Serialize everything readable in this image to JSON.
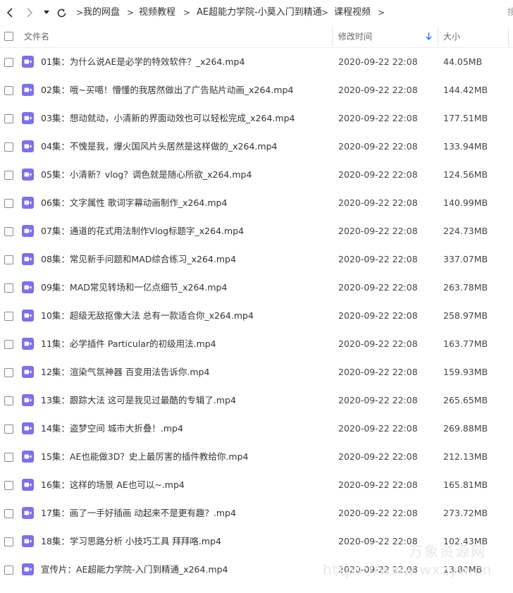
{
  "toolbar": {
    "back_icon": "chevron-left-icon",
    "forward_icon": "chevron-right-icon",
    "history_icon": "caret-down-icon",
    "refresh_icon": "refresh-icon"
  },
  "breadcrumb": [
    "我的网盘",
    "视频教程",
    "AE超能力学院-小莫入门到精通",
    "课程视频"
  ],
  "breadcrumb_separator": ">",
  "search_stub": "搜",
  "columns": {
    "name": "文件名",
    "modified": "修改时间",
    "size": "大小",
    "sort_icon": "arrow-down-icon"
  },
  "colors": {
    "video_icon": "#7c6ff0",
    "sort_arrow": "#2f7ef3"
  },
  "files": [
    {
      "name": "01集：为什么说AE是必学的特效软件？_x264.mp4",
      "modified": "2020-09-22 22:08",
      "size": "44.05MB"
    },
    {
      "name": "02集：哦~买噶！懵懂的我居然做出了广告贴片动画_x264.mp4",
      "modified": "2020-09-22 22:08",
      "size": "144.42MB"
    },
    {
      "name": "03集：想动就动，小清新的界面动效也可以轻松完成_x264.mp4",
      "modified": "2020-09-22 22:08",
      "size": "177.51MB"
    },
    {
      "name": "04集：不愧是我，爆火国风片头居然是这样做的_x264.mp4",
      "modified": "2020-09-22 22:08",
      "size": "133.94MB"
    },
    {
      "name": "05集：小清新？vlog？调色就是随心所欲_x264.mp4",
      "modified": "2020-09-22 22:08",
      "size": "124.56MB"
    },
    {
      "name": "06集：文字属性 歌词字幕动画制作_x264.mp4",
      "modified": "2020-09-22 22:08",
      "size": "140.99MB"
    },
    {
      "name": "07集：通道的花式用法制作Vlog标题字_x264.mp4",
      "modified": "2020-09-22 22:08",
      "size": "224.73MB"
    },
    {
      "name": "08集：常见新手问题和MAD综合练习_x264.mp4",
      "modified": "2020-09-22 22:08",
      "size": "337.07MB"
    },
    {
      "name": "09集：MAD常见转场和一亿点细节_x264.mp4",
      "modified": "2020-09-22 22:08",
      "size": "263.78MB"
    },
    {
      "name": "10集：超级无敌抠像大法 总有一款适合你_x264.mp4",
      "modified": "2020-09-22 22:08",
      "size": "258.97MB"
    },
    {
      "name": "11集：必学插件 Particular的初级用法.mp4",
      "modified": "2020-09-22 22:08",
      "size": "163.77MB"
    },
    {
      "name": "12集：渲染气氛神器 百变用法告诉你.mp4",
      "modified": "2020-09-22 22:08",
      "size": "159.93MB"
    },
    {
      "name": "13集：跟踪大法 这可是我见过最酷的专辑了.mp4",
      "modified": "2020-09-22 22:08",
      "size": "265.65MB"
    },
    {
      "name": "14集：盗梦空间 城市大折叠！.mp4",
      "modified": "2020-09-22 22:08",
      "size": "269.88MB"
    },
    {
      "name": "15集：AE也能做3D？史上最厉害的插件教给你.mp4",
      "modified": "2020-09-22 22:08",
      "size": "212.13MB"
    },
    {
      "name": "16集：这样的场景 AE也可以~.mp4",
      "modified": "2020-09-22 22:08",
      "size": "165.81MB"
    },
    {
      "name": "17集：画了一手好插画 动起来不是更有趣？.mp4",
      "modified": "2020-09-22 22:08",
      "size": "273.72MB"
    },
    {
      "name": "18集：学习思路分析 小技巧工具 拜拜咯.mp4",
      "modified": "2020-09-22 22:08",
      "size": "102.43MB"
    },
    {
      "name": "宣传片：AE超能力学院-入门到精通_x264.mp4",
      "modified": "2020-09-22 22:08",
      "size": "13.80MB"
    }
  ],
  "watermark": {
    "text": "万象资源网",
    "url": "https://www.wxzyw.cn"
  }
}
